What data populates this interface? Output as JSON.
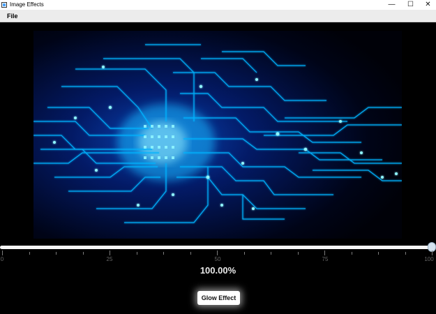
{
  "window": {
    "title": "Image Effects"
  },
  "menu": {
    "file_label": "File"
  },
  "slider": {
    "tick_labels": [
      "0",
      "25",
      "50",
      "75",
      "100"
    ],
    "value_percent": 100,
    "readout": "100.00%"
  },
  "buttons": {
    "glow_label": "Glow Effect"
  },
  "colors": {
    "image_glow": "#00aaff",
    "image_bright": "#7fefff"
  }
}
